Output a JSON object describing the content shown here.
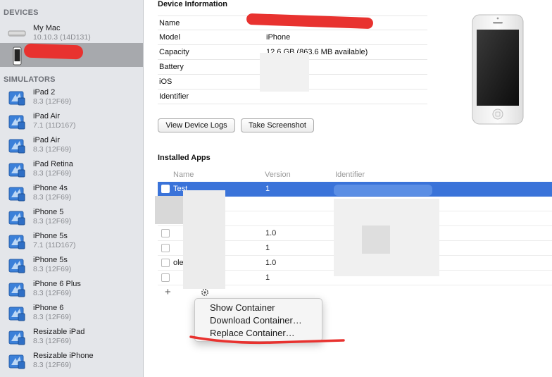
{
  "sidebar": {
    "devices_header": "DEVICES",
    "simulators_header": "SIMULATORS",
    "devices": [
      {
        "name": "My Mac",
        "sub": "10.10.3 (14D131)",
        "icon": "mac-mini-icon"
      }
    ],
    "simulators": [
      {
        "name": "iPad 2",
        "sub": "8.3 (12F69)"
      },
      {
        "name": "iPad Air",
        "sub": "7.1 (11D167)"
      },
      {
        "name": "iPad Air",
        "sub": "8.3 (12F69)"
      },
      {
        "name": "iPad Retina",
        "sub": "8.3 (12F69)"
      },
      {
        "name": "iPhone 4s",
        "sub": "8.3 (12F69)"
      },
      {
        "name": "iPhone 5",
        "sub": "8.3 (12F69)"
      },
      {
        "name": "iPhone 5s",
        "sub": "7.1 (11D167)"
      },
      {
        "name": "iPhone 5s",
        "sub": "8.3 (12F69)"
      },
      {
        "name": "iPhone 6 Plus",
        "sub": "8.3 (12F69)"
      },
      {
        "name": "iPhone 6",
        "sub": "8.3 (12F69)"
      },
      {
        "name": "Resizable iPad",
        "sub": "8.3 (12F69)"
      },
      {
        "name": "Resizable iPhone",
        "sub": "8.3 (12F69)"
      }
    ]
  },
  "device_info": {
    "title": "Device Information",
    "rows": [
      {
        "label": "Name",
        "value": ""
      },
      {
        "label": "Model",
        "value": "iPhone"
      },
      {
        "label": "Capacity",
        "value": "12.6 GB (863.6 MB available)"
      },
      {
        "label": "Battery",
        "value": ""
      },
      {
        "label": "iOS",
        "value": ""
      },
      {
        "label": "Identifier",
        "value": ""
      }
    ],
    "view_logs_button": "View Device Logs",
    "screenshot_button": "Take Screenshot"
  },
  "installed_apps": {
    "title": "Installed Apps",
    "columns": {
      "name": "Name",
      "version": "Version",
      "identifier": "Identifier"
    },
    "rows": [
      {
        "name": "Test",
        "version": "1"
      },
      {
        "name": "",
        "version": ""
      },
      {
        "name": "",
        "version": ""
      },
      {
        "name": "",
        "version": "1.0"
      },
      {
        "name": "",
        "version": "1"
      },
      {
        "name": "ole",
        "version": "1.0"
      },
      {
        "name": "",
        "version": "1"
      }
    ],
    "add_label": "+"
  },
  "context_menu": {
    "items": [
      "Show Container",
      "Download Container…",
      "Replace Container…"
    ]
  },
  "colors": {
    "selection": "#3a73d9",
    "sidebar_bg": "#e4e6ea",
    "redaction": "#e8322f"
  }
}
